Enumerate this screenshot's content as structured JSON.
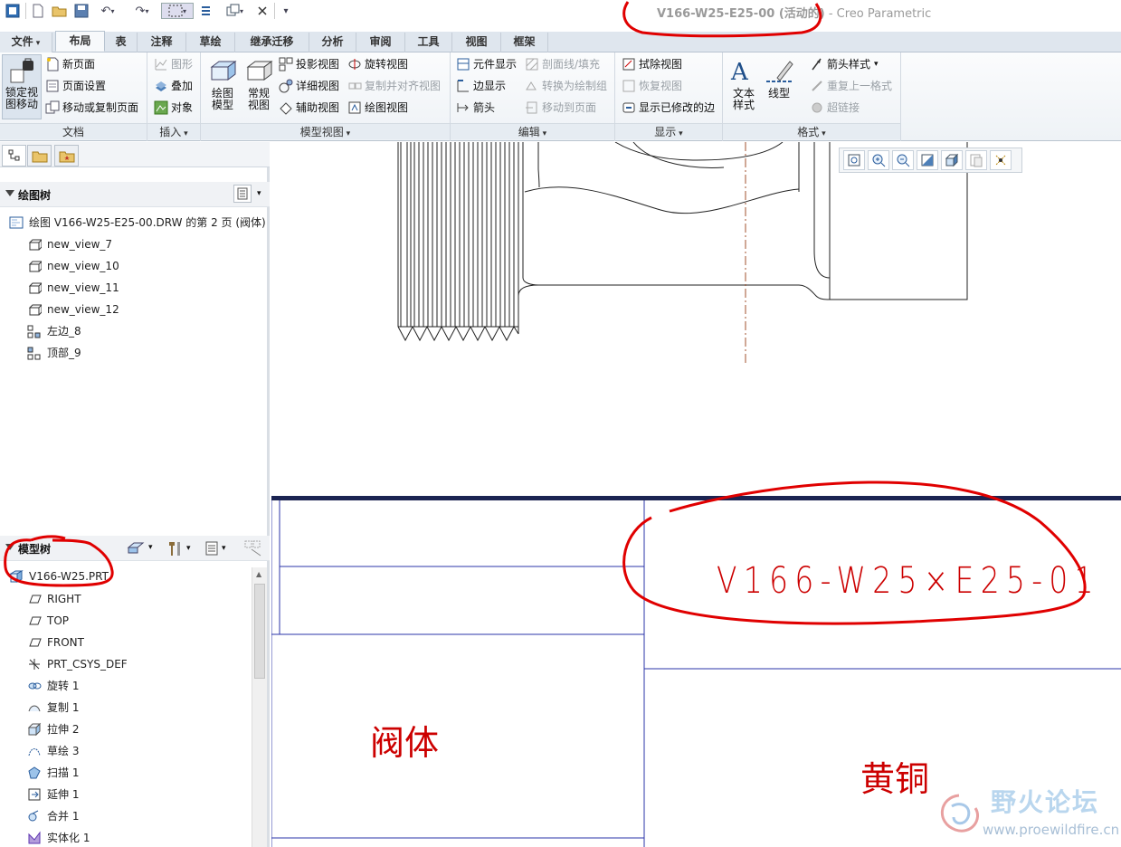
{
  "window": {
    "title_main": "V166-W25-E25-00 (活动的)",
    "title_suffix": " - Creo Parametric"
  },
  "ribbon_tabs": [
    "文件",
    "布局",
    "表",
    "注释",
    "草绘",
    "继承迁移",
    "分析",
    "审阅",
    "工具",
    "视图",
    "框架"
  ],
  "active_tab": "布局",
  "ribbon": {
    "doc": {
      "label": "文档",
      "lock_label_1": "锁定视",
      "lock_label_2": "图移动",
      "items": [
        "新页面",
        "页面设置",
        "移动或复制页面"
      ]
    },
    "insert": {
      "label": "插入",
      "items": [
        "图形",
        "叠加",
        "对象"
      ]
    },
    "model_views": {
      "label": "模型视图",
      "big1_1": "绘图",
      "big1_2": "模型",
      "big2_1": "常规",
      "big2_2": "视图",
      "col1": [
        "投影视图",
        "详细视图",
        "辅助视图"
      ],
      "col2": [
        "旋转视图",
        "复制并对齐视图",
        "绘图视图"
      ]
    },
    "edit": {
      "label": "编辑",
      "col1": [
        "元件显示",
        "边显示",
        "箭头"
      ],
      "col2": [
        "剖面线/填充",
        "转换为绘制组",
        "移动到页面"
      ]
    },
    "display": {
      "label": "显示",
      "items": [
        "拭除视图",
        "恢复视图",
        "显示已修改的边"
      ]
    },
    "format": {
      "label": "格式",
      "big1_1": "文本",
      "big1_2": "样式",
      "big2": "线型",
      "items": [
        "箭头样式",
        "重复上一格式",
        "超链接"
      ]
    }
  },
  "drawing_tree": {
    "title": "绘图树",
    "root": "绘图 V166-W25-E25-00.DRW 的第 2 页 (阀体)",
    "items": [
      "new_view_7",
      "new_view_10",
      "new_view_11",
      "new_view_12",
      "左边_8",
      "顶部_9"
    ]
  },
  "model_tree": {
    "title": "模型树",
    "root": "V166-W25.PRT",
    "items": [
      "RIGHT",
      "TOP",
      "FRONT",
      "PRT_CSYS_DEF",
      "旋转 1",
      "复制 1",
      "拉伸 2",
      "草绘 3",
      "扫描 1",
      "延伸 1",
      "合并 1",
      "实体化 1"
    ]
  },
  "title_block": {
    "drawing_number": "V166-W25×E25-01",
    "part_name": "阀体",
    "material": "黄铜"
  },
  "watermark": {
    "brand": "野火论坛",
    "url": "www.proewildfire.cn"
  },
  "colors": {
    "annotation_red": "#e00000",
    "cad_text_red": "#cc0000",
    "border_navy": "#1b2452",
    "table_line_blue": "#2b34a8",
    "centerline_brown": "#a0522d"
  }
}
